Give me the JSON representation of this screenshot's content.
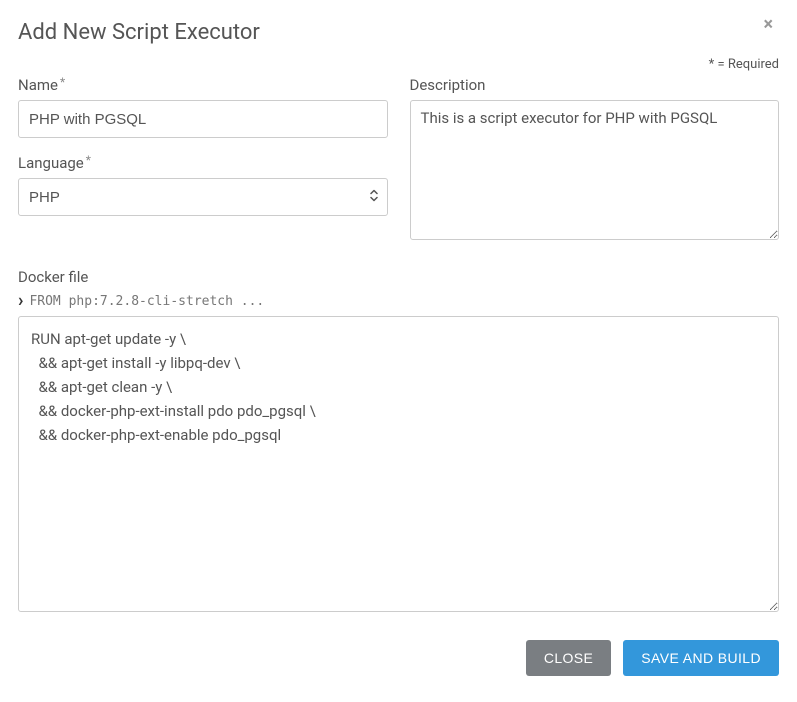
{
  "modal": {
    "title": "Add New Script Executor",
    "requiredNote": "* = Required"
  },
  "fields": {
    "name": {
      "label": "Name",
      "value": "PHP with PGSQL"
    },
    "language": {
      "label": "Language",
      "selected": "PHP"
    },
    "description": {
      "label": "Description",
      "value": "This is a script executor for PHP with PGSQL"
    },
    "dockerfile": {
      "label": "Docker file",
      "hint": "FROM php:7.2.8-cli-stretch ...",
      "value": "RUN apt-get update -y \\\n  && apt-get install -y libpq-dev \\\n  && apt-get clean -y \\\n  && docker-php-ext-install pdo pdo_pgsql \\\n  && docker-php-ext-enable pdo_pgsql"
    }
  },
  "buttons": {
    "close": "CLOSE",
    "saveBuild": "SAVE AND BUILD"
  }
}
